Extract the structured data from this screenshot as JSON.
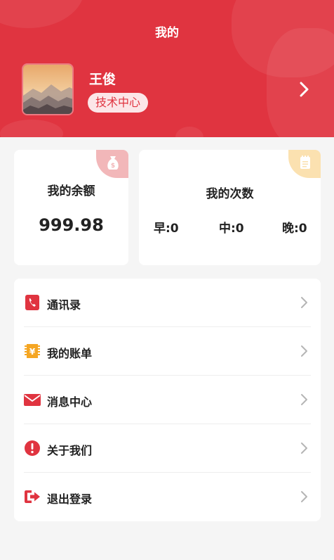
{
  "header": {
    "title": "我的",
    "user_name": "王俊",
    "role": "技术中心",
    "background_color": "#e03440"
  },
  "balance_card": {
    "title": "我的余额",
    "value": "999.98",
    "corner_icon": "money-bag-icon"
  },
  "counts_card": {
    "title": "我的次数",
    "corner_icon": "notepad-icon",
    "items": [
      {
        "label": "早:0"
      },
      {
        "label": "中:0"
      },
      {
        "label": "晚:0"
      }
    ]
  },
  "menu": [
    {
      "label": "通讯录",
      "icon": "phone-book-icon"
    },
    {
      "label": "我的账单",
      "icon": "yen-bill-icon"
    },
    {
      "label": "消息中心",
      "icon": "envelope-icon"
    },
    {
      "label": "关于我们",
      "icon": "info-icon"
    },
    {
      "label": "退出登录",
      "icon": "logout-icon"
    }
  ]
}
